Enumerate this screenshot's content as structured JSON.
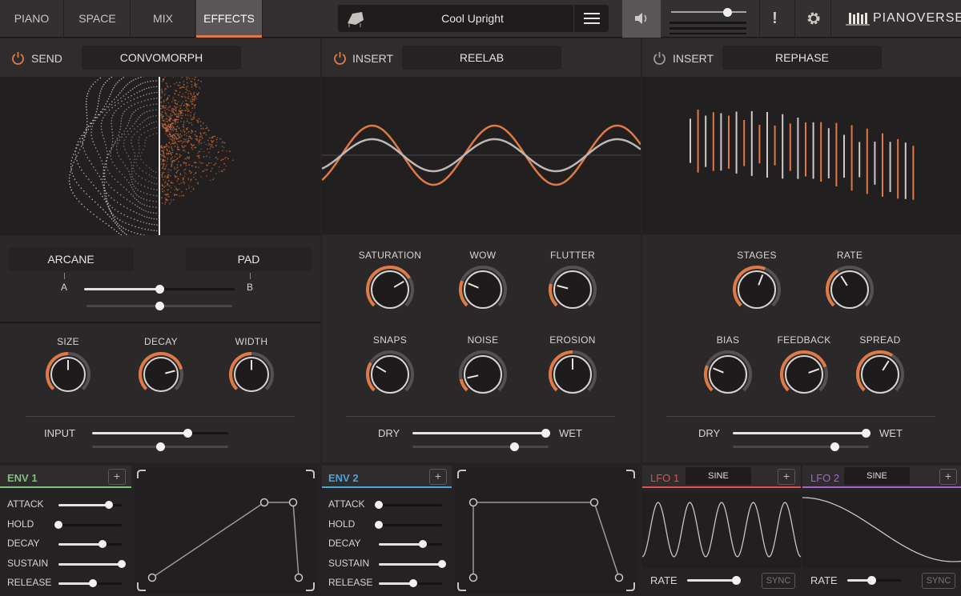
{
  "tabs": [
    {
      "label": "PIANO"
    },
    {
      "label": "SPACE"
    },
    {
      "label": "MIX"
    },
    {
      "label": "EFFECTS",
      "active": true
    }
  ],
  "preset": {
    "name": "Cool Upright"
  },
  "brand": "PIANOVERSE",
  "warning_symbol": "!",
  "master_volume": 0.75,
  "colors": {
    "accent": "#e07a45",
    "env1": "#7fc27a",
    "env2": "#4aa6d8",
    "lfo1": "#e0504f",
    "lfo2": "#a564c9",
    "knob_track": "#555152"
  },
  "effects": {
    "send": {
      "slot": "SEND",
      "name": "CONVOMORPH",
      "power": "on",
      "morph_a": "ARCANE",
      "morph_b": "PAD",
      "a_label": "A",
      "b_label": "B",
      "morph_value": 0.5,
      "morph_value2": 0.5,
      "knobs": [
        {
          "label": "SIZE",
          "value": 0.5
        },
        {
          "label": "DECAY",
          "value": 0.78
        },
        {
          "label": "WIDTH",
          "value": 0.5
        }
      ],
      "input_label": "INPUT",
      "input_value": 0.7,
      "input_value2": 0.5
    },
    "insert1": {
      "slot": "INSERT",
      "name": "REELAB",
      "power": "on",
      "knobs": [
        {
          "label": "SATURATION",
          "value": 0.72
        },
        {
          "label": "WOW",
          "value": 0.25
        },
        {
          "label": "FLUTTER",
          "value": 0.22
        },
        {
          "label": "SNAPS",
          "value": 0.28
        },
        {
          "label": "NOISE",
          "value": 0.12
        },
        {
          "label": "EROSION",
          "value": 0.5
        }
      ],
      "dry_label": "DRY",
      "wet_label": "WET",
      "mix_value": 0.98,
      "mix_value2": 0.75
    },
    "insert2": {
      "slot": "INSERT",
      "name": "REPHASE",
      "power": "off",
      "knobs": [
        {
          "label": "STAGES",
          "value": 0.58
        },
        {
          "label": "RATE",
          "value": 0.38
        },
        {
          "label": "BIAS",
          "value": 0.25
        },
        {
          "label": "FEEDBACK",
          "value": 0.76
        },
        {
          "label": "SPREAD",
          "value": 0.62
        }
      ],
      "dry_label": "DRY",
      "wet_label": "WET",
      "mix_value": 0.98,
      "mix_value2": 0.75
    }
  },
  "env1": {
    "title": "ENV 1",
    "add": "+",
    "params": [
      {
        "label": "ATTACK",
        "value": 0.8
      },
      {
        "label": "HOLD",
        "value": 0.0
      },
      {
        "label": "DECAY",
        "value": 0.7
      },
      {
        "label": "SUSTAIN",
        "value": 1.0
      },
      {
        "label": "RELEASE",
        "value": 0.55
      }
    ]
  },
  "env2": {
    "title": "ENV 2",
    "add": "+",
    "params": [
      {
        "label": "ATTACK",
        "value": 0.0
      },
      {
        "label": "HOLD",
        "value": 0.0
      },
      {
        "label": "DECAY",
        "value": 0.7
      },
      {
        "label": "SUSTAIN",
        "value": 1.0
      },
      {
        "label": "RELEASE",
        "value": 0.55
      }
    ]
  },
  "lfo1": {
    "title": "LFO 1",
    "wave": "SINE",
    "add": "+",
    "rate_label": "RATE",
    "rate_value": 0.9,
    "sync_label": "SYNC"
  },
  "lfo2": {
    "title": "LFO 2",
    "wave": "SINE",
    "add": "+",
    "rate_label": "RATE",
    "rate_value": 0.45,
    "sync_label": "SYNC"
  }
}
